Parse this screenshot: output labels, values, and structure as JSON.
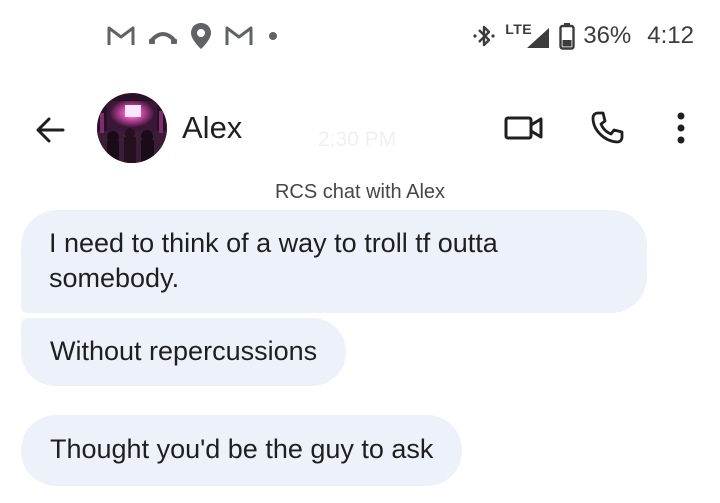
{
  "status_bar": {
    "notification_icons": [
      "gmail-icon",
      "missed-call-icon",
      "location-icon",
      "gmail-icon",
      "dot-icon"
    ],
    "bluetooth_icon": "bluetooth-icon",
    "network_type": "LTE",
    "signal_icon": "cell-signal-icon",
    "battery_icon": "battery-icon",
    "battery_percent": "36%",
    "time": "4:12"
  },
  "app_bar": {
    "back_icon": "arrow-back-icon",
    "contact_name": "Alex",
    "faint_timestamp": "2:30 PM",
    "video_call_icon": "videocam-icon",
    "voice_call_icon": "phone-icon",
    "overflow_icon": "more-vert-icon"
  },
  "conversation": {
    "header": "RCS chat with Alex",
    "messages": [
      {
        "direction": "incoming",
        "text": "I need to think of a way to troll tf outta somebody."
      },
      {
        "direction": "incoming",
        "text": "Without repercussions"
      },
      {
        "direction": "incoming",
        "text": "Thought you'd be the guy to ask"
      }
    ]
  },
  "colors": {
    "incoming_bubble": "#edf1f9",
    "primary_text": "#1f1f1f",
    "secondary_text": "#444746",
    "icon": "#1f1f1f"
  }
}
